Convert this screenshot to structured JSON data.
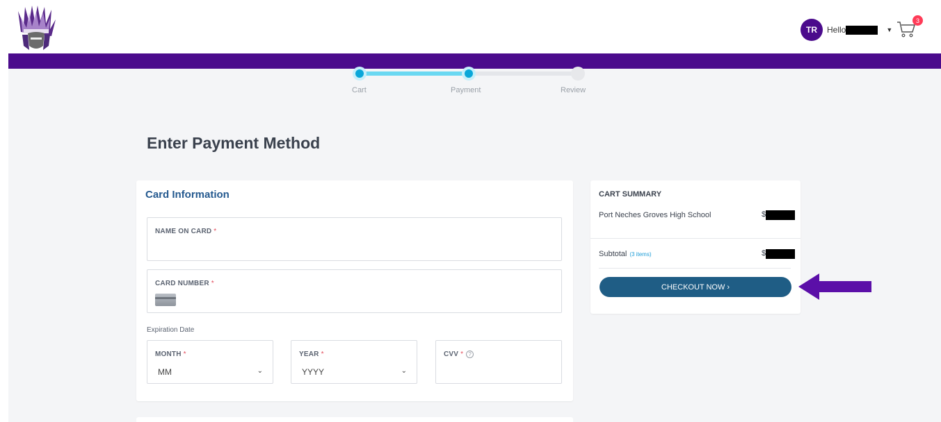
{
  "header": {
    "avatar_initials": "TR",
    "greeting": "Hello",
    "cart_count": "3",
    "brand_color": "#4b0b8c"
  },
  "progress": {
    "steps": [
      {
        "label": "Cart",
        "state": "done"
      },
      {
        "label": "Payment",
        "state": "done"
      },
      {
        "label": "Review",
        "state": "todo"
      }
    ]
  },
  "page_title": "Enter Payment Method",
  "card_form": {
    "title": "Card Information",
    "name_label": "NAME ON CARD",
    "number_label": "CARD NUMBER",
    "required_mark": "*",
    "expiration_label": "Expiration Date",
    "month_label": "MONTH",
    "month_value": "MM",
    "year_label": "YEAR",
    "year_value": "YYYY",
    "cvv_label": "CVV",
    "cvv_help": "?"
  },
  "summary": {
    "title": "CART SUMMARY",
    "item_name": "Port Neches Groves High School",
    "subtotal_label": "Subtotal",
    "items_count": "(3 items)",
    "checkout_label": "CHECKOUT NOW  ›",
    "accent_color": "#1f5d85"
  },
  "annotation": {
    "arrow_color": "#5b0fa8"
  }
}
